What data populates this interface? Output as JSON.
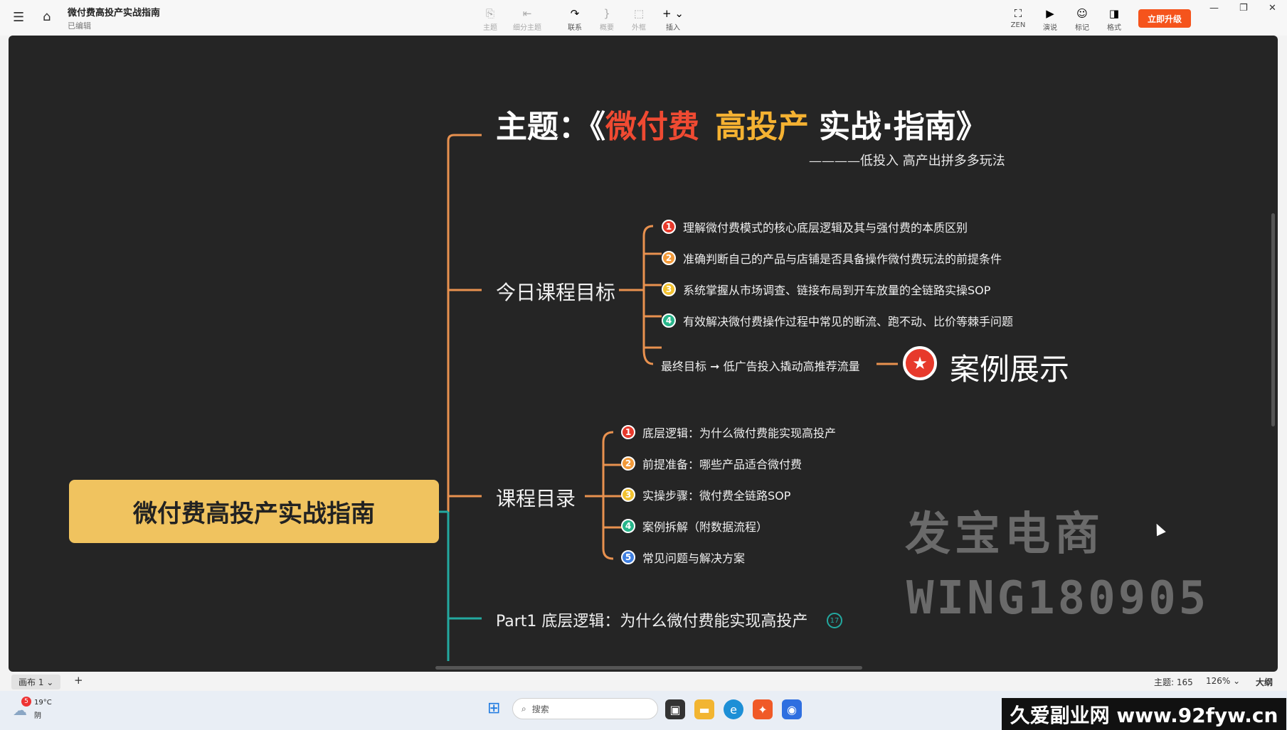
{
  "app": {
    "doc_title": "微付费高投产实战指南",
    "doc_status": "已编辑",
    "upgrade_label": "立即升级"
  },
  "toolbar": [
    {
      "label": "主题",
      "icon": "topic-icon",
      "glyph": "⎘",
      "enabled": false
    },
    {
      "label": "细分主题",
      "icon": "subtopic-icon",
      "glyph": "⇤",
      "enabled": false
    },
    {
      "label": "联系",
      "icon": "relation-icon",
      "glyph": "↷",
      "enabled": true
    },
    {
      "label": "概要",
      "icon": "summary-icon",
      "glyph": "}",
      "enabled": false
    },
    {
      "label": "外框",
      "icon": "boundary-icon",
      "glyph": "⬚",
      "enabled": false
    },
    {
      "label": "插入",
      "icon": "insert-icon",
      "glyph": "+ ⌄",
      "enabled": true
    }
  ],
  "right_tools": [
    {
      "label": "ZEN",
      "icon": "zen-icon",
      "glyph": "⛶"
    },
    {
      "label": "演说",
      "icon": "present-icon",
      "glyph": "▶"
    },
    {
      "label": "标记",
      "icon": "marker-icon",
      "glyph": "☺"
    },
    {
      "label": "格式",
      "icon": "format-icon",
      "glyph": "◨"
    }
  ],
  "mindmap": {
    "root": "微付费高投产实战指南",
    "title": {
      "prefix": "主题：《",
      "part_red": "微付费",
      "part_orange": "高投产",
      "part_white": "实战·指南》"
    },
    "subtitle": "————低投入 高产出拼多多玩法",
    "goals_label": "今日课程目标",
    "goals": [
      {
        "n": "1",
        "text": "理解微付费模式的核心底层逻辑及其与强付费的本质区别"
      },
      {
        "n": "2",
        "text": "准确判断自己的产品与店铺是否具备操作微付费玩法的前提条件"
      },
      {
        "n": "3",
        "text": "系统掌握从市场调查、链接布局到开车放量的全链路实操SOP"
      },
      {
        "n": "4",
        "text": "有效解决微付费操作过程中常见的断流、跑不动、比价等棘手问题"
      }
    ],
    "final_goal": "最终目标 ➞ 低广告投入撬动高推荐流量",
    "case_label": "案例展示",
    "catalog_label": "课程目录",
    "catalog": [
      {
        "n": "1",
        "text": "底层逻辑：为什么微付费能实现高投产"
      },
      {
        "n": "2",
        "text": "前提准备：哪些产品适合微付费"
      },
      {
        "n": "3",
        "text": "实操步骤：微付费全链路SOP"
      },
      {
        "n": "4",
        "text": "案例拆解（附数据流程）"
      },
      {
        "n": "5",
        "text": "常见问题与解决方案"
      }
    ],
    "part1_label": "Part1 底层逻辑：为什么微付费能实现高投产",
    "part1_fold_count": "17"
  },
  "watermark": {
    "line1": "发宝电商",
    "line2": "WING180905"
  },
  "statusbar": {
    "canvas_tab": "画布 1 ⌄",
    "add_tab": "+",
    "topic_count": "主题: 165",
    "zoom": "126% ⌄",
    "outline": "大纲"
  },
  "taskbar": {
    "weather_badge": "5",
    "weather_temp": "19°C",
    "weather_desc": "阴",
    "search_placeholder": "搜索"
  },
  "site_banner": "久爱副业网 www.92fyw.cn",
  "colors": {
    "orange_line": "#e8914f",
    "teal_line": "#23a9a0",
    "num1": "#e7392b",
    "num2": "#f29a3a",
    "num3": "#f2c230",
    "num4": "#27b58a",
    "num5": "#3f7fe0"
  }
}
